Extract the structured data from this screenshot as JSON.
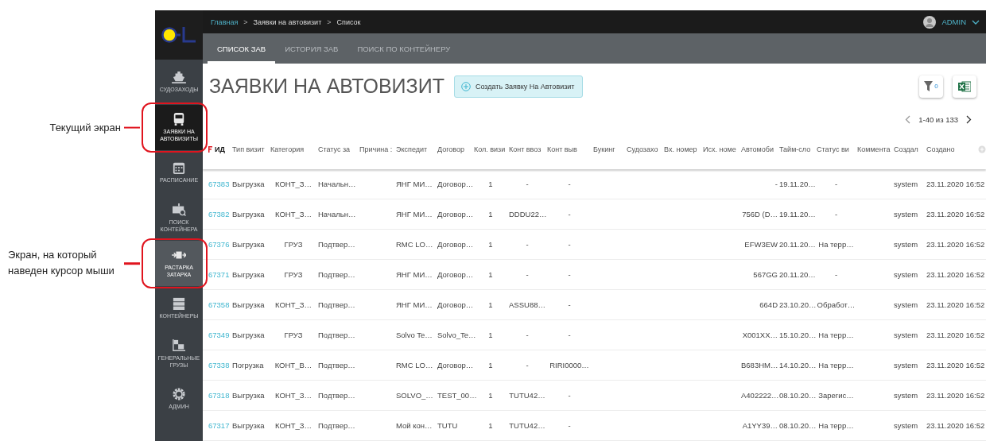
{
  "sidebar": {
    "items": [
      {
        "label": "СУДОЗАХОДЫ",
        "selected": false,
        "hovered": false
      },
      {
        "label": "ЗАЯВКИ НА АВТОВИЗИТЫ",
        "selected": true,
        "hovered": false,
        "callout": "Текущий экран"
      },
      {
        "label": "РАСПИСАНИЕ",
        "selected": false,
        "hovered": false
      },
      {
        "label": "ПОИСК КОНТЕЙНЕРА",
        "selected": false,
        "hovered": false
      },
      {
        "label": "РАСТАРКА ЗАТАРКА",
        "selected": false,
        "hovered": true,
        "callout": "Экран, на который наведен курсор мыши"
      },
      {
        "label": "КОНТЕЙНЕРЫ",
        "selected": false,
        "hovered": false
      },
      {
        "label": "ГЕНЕРАЛЬНЫЕ ГРУЗЫ",
        "selected": false,
        "hovered": false
      },
      {
        "label": "АДМИН",
        "selected": false,
        "hovered": false
      }
    ]
  },
  "breadcrumbs": [
    {
      "label": "Главная",
      "link": true
    },
    {
      "label": "Заявки на автовизит",
      "link": false
    },
    {
      "label": "Список",
      "link": false
    }
  ],
  "separator": ">",
  "user": {
    "name": "ADMIN"
  },
  "tabs": [
    {
      "label": "СПИСОК ЗАВ",
      "selected": true
    },
    {
      "label": "ИСТОРИЯ ЗАВ",
      "selected": false
    },
    {
      "label": "ПОИСК ПО КОНТЕЙНЕРУ",
      "selected": false
    }
  ],
  "page_title": "ЗАЯВКИ НА АВТОВИЗИТ",
  "create_button": "Создать Заявку На Автовизит",
  "filter_count": "0",
  "pagination": {
    "range": "1-40 из 133"
  },
  "table": {
    "columns": [
      {
        "label": "ИД",
        "sorted": true
      },
      {
        "label": "Тип визит",
        "sorted": false
      },
      {
        "label": "Категория",
        "sorted": false
      },
      {
        "label": "Статус за",
        "sorted": false
      },
      {
        "label": "Причина :",
        "sorted": false
      },
      {
        "label": "Экспедит",
        "sorted": false
      },
      {
        "label": "Договор",
        "sorted": false
      },
      {
        "label": "Кол. визи",
        "sorted": false
      },
      {
        "label": "Конт ввоз",
        "sorted": false
      },
      {
        "label": "Конт выв",
        "sorted": false
      },
      {
        "label": "Букинг",
        "sorted": false
      },
      {
        "label": "Судозахо",
        "sorted": false
      },
      {
        "label": "Вх. номер",
        "sorted": false
      },
      {
        "label": "Исх. номе",
        "sorted": false
      },
      {
        "label": "Автомоби",
        "sorted": false
      },
      {
        "label": "Тайм-сло",
        "sorted": false
      },
      {
        "label": "Статус ви",
        "sorted": false
      },
      {
        "label": "Коммента",
        "sorted": false
      },
      {
        "label": "Создал",
        "sorted": false
      },
      {
        "label": "Создано",
        "sorted": false
      }
    ],
    "rows": [
      {
        "id": "67383",
        "visit_type": "Выгрузка",
        "category": "КОНТ_З…",
        "request_status": "Начальн…",
        "forwarder": "ЯНГ МИ…",
        "contract": "Договор…",
        "visit_count": "1",
        "container_in": "-",
        "container_out": "-",
        "vehicle": "-",
        "time_slot": "19.11.20…",
        "visit_status": "-",
        "created_by": "system",
        "created_at": "23.11.2020 16:52"
      },
      {
        "id": "67382",
        "visit_type": "Выгрузка",
        "category": "КОНТ_З…",
        "request_status": "Начальн…",
        "forwarder": "ЯНГ МИ…",
        "contract": "Договор…",
        "visit_count": "1",
        "container_in": "DDDU22…",
        "container_out": "-",
        "vehicle": "756D (D…",
        "time_slot": "19.11.20…",
        "visit_status": "-",
        "created_by": "system",
        "created_at": "23.11.2020 16:52"
      },
      {
        "id": "67376",
        "visit_type": "Выгрузка",
        "category": "ГРУЗ",
        "request_status": "Подтвер…",
        "forwarder": "RMC LO…",
        "contract": "Договор…",
        "visit_count": "1",
        "container_in": "-",
        "container_out": "-",
        "vehicle": "EFW3EW",
        "time_slot": "20.11.20…",
        "visit_status": "На терр…",
        "created_by": "system",
        "created_at": "23.11.2020 16:52"
      },
      {
        "id": "67371",
        "visit_type": "Выгрузка",
        "category": "ГРУЗ",
        "request_status": "Подтвер…",
        "forwarder": "ЯНГ МИ…",
        "contract": "Договор…",
        "visit_count": "1",
        "container_in": "-",
        "container_out": "-",
        "vehicle": "567GG",
        "time_slot": "20.11.20…",
        "visit_status": "-",
        "created_by": "system",
        "created_at": "23.11.2020 16:52"
      },
      {
        "id": "67358",
        "visit_type": "Выгрузка",
        "category": "КОНТ_З…",
        "request_status": "Подтвер…",
        "forwarder": "ЯНГ МИ…",
        "contract": "Договор…",
        "visit_count": "1",
        "container_in": "ASSU88…",
        "container_out": "-",
        "vehicle": "664D",
        "time_slot": "23.10.20…",
        "visit_status": "Обработ…",
        "created_by": "system",
        "created_at": "23.11.2020 16:52"
      },
      {
        "id": "67349",
        "visit_type": "Выгрузка",
        "category": "ГРУЗ",
        "request_status": "Подтвер…",
        "forwarder": "Solvo Te…",
        "contract": "Solvo_Te…",
        "visit_count": "1",
        "container_in": "-",
        "container_out": "-",
        "vehicle": "X001XX…",
        "time_slot": "15.10.20…",
        "visit_status": "На терр…",
        "created_by": "system",
        "created_at": "23.11.2020 16:52"
      },
      {
        "id": "67338",
        "visit_type": "Погрузка",
        "category": "КОНТ_В…",
        "request_status": "Подтвер…",
        "forwarder": "RMC LO…",
        "contract": "Договор…",
        "visit_count": "1",
        "container_in": "-",
        "container_out": "RIRI0000…",
        "vehicle": "B683HM…",
        "time_slot": "14.10.20…",
        "visit_status": "На терр…",
        "created_by": "system",
        "created_at": "23.11.2020 16:52"
      },
      {
        "id": "67318",
        "visit_type": "Выгрузка",
        "category": "КОНТ_З…",
        "request_status": "Подтвер…",
        "forwarder": "SOLVO_…",
        "contract": "TEST_00…",
        "visit_count": "1",
        "container_in": "TUTU42…",
        "container_out": "-",
        "vehicle": "A402222…",
        "time_slot": "08.10.20…",
        "visit_status": "Зарегис…",
        "created_by": "system",
        "created_at": "23.11.2020 16:52"
      },
      {
        "id": "67317",
        "visit_type": "Выгрузка",
        "category": "КОНТ_З…",
        "request_status": "Подтвер…",
        "forwarder": "Мой кон…",
        "contract": "TUTU",
        "visit_count": "1",
        "container_in": "TUTU42…",
        "container_out": "-",
        "vehicle": "A1YY39…",
        "time_slot": "08.10.20…",
        "visit_status": "На терр…",
        "created_by": "system",
        "created_at": "23.11.2020 16:52"
      }
    ]
  }
}
